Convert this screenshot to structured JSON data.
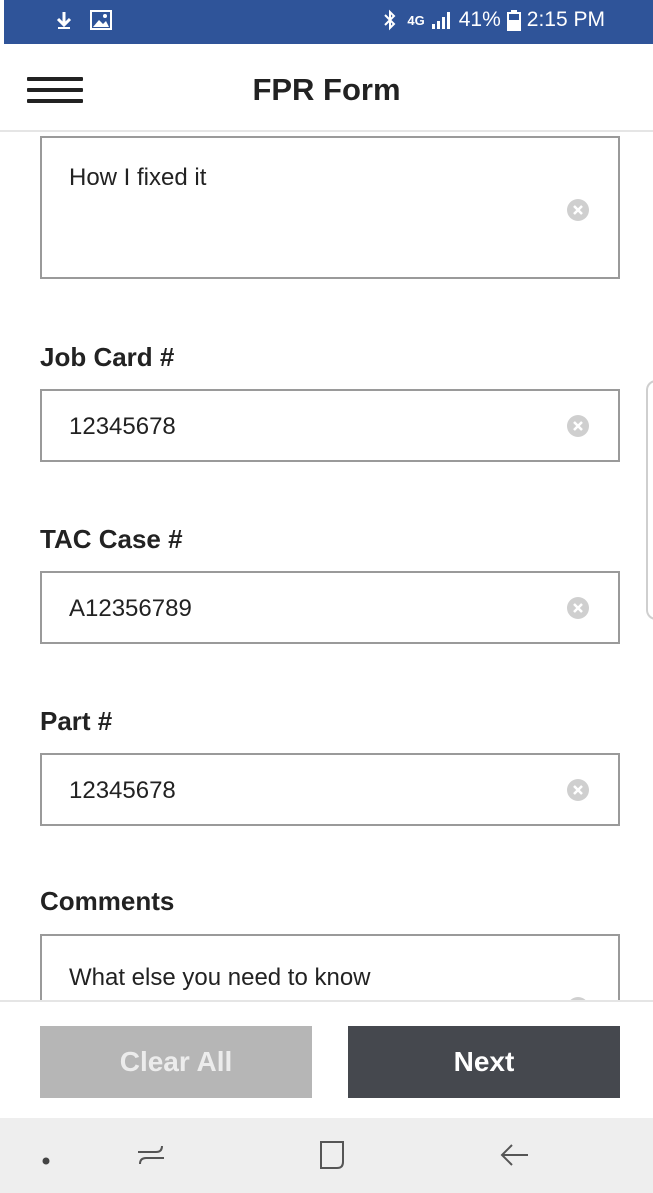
{
  "status_bar": {
    "network": "4G",
    "battery": "41%",
    "time": "2:15 PM",
    "icons": [
      "download-icon",
      "image-icon",
      "bluetooth-icon",
      "signal-icon",
      "battery-icon"
    ]
  },
  "header": {
    "title": "FPR Form",
    "menu_icon": "hamburger-menu-icon"
  },
  "form": {
    "fix_description": {
      "value": "How I fixed it"
    },
    "job_card": {
      "label": "Job Card #",
      "value": "12345678"
    },
    "tac_case": {
      "label": "TAC Case #",
      "value": "A12356789"
    },
    "part": {
      "label": "Part #",
      "value": "12345678"
    },
    "comments": {
      "label": "Comments",
      "value": "What else you need to know"
    }
  },
  "actions": {
    "clear_label": "Clear All",
    "next_label": "Next"
  },
  "colors": {
    "status_bar": "#2f5499",
    "next_button": "#45484e",
    "clear_button": "#b6b6b6",
    "nav_bar": "#eeeeee"
  }
}
